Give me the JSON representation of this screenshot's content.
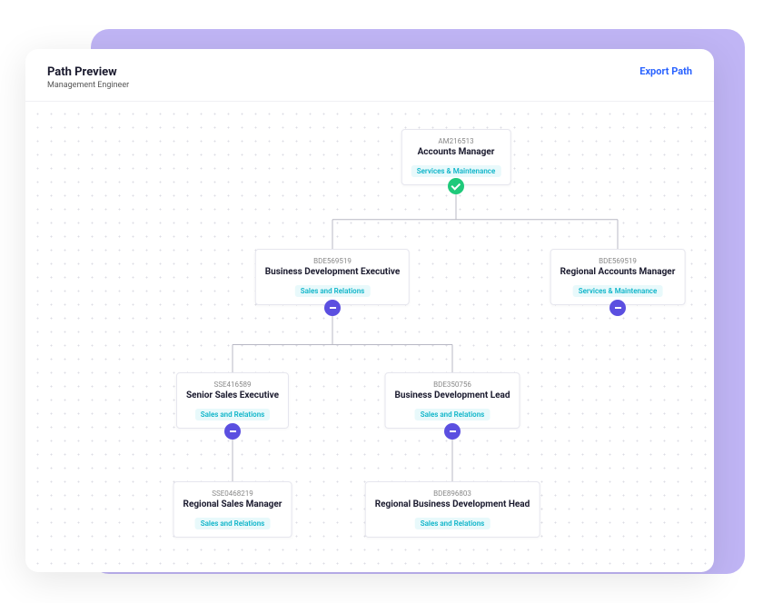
{
  "header": {
    "title": "Path Preview",
    "subtitle": "Management Engineer",
    "export_label": "Export Path"
  },
  "nodes": {
    "root": {
      "code": "AM216513",
      "title": "Accounts Manager",
      "tag": "Services & Maintenance"
    },
    "level2a": {
      "code": "BDE569519",
      "title": "Business Development Executive",
      "tag": "Sales and Relations"
    },
    "level2b": {
      "code": "BDE569519",
      "title": "Regional Accounts Manager",
      "tag": "Services & Maintenance"
    },
    "level3a": {
      "code": "SSE416589",
      "title": "Senior Sales Executive",
      "tag": "Sales and Relations"
    },
    "level3b": {
      "code": "BDE350756",
      "title": "Business Development Lead",
      "tag": "Sales and Relations"
    },
    "level4a": {
      "code": "SSE0468219",
      "title": "Regional Sales Manager",
      "tag": "Sales and Relations"
    },
    "level4b": {
      "code": "BDE896803",
      "title": "Regional Business Development Head",
      "tag": "Sales and Relations"
    }
  }
}
